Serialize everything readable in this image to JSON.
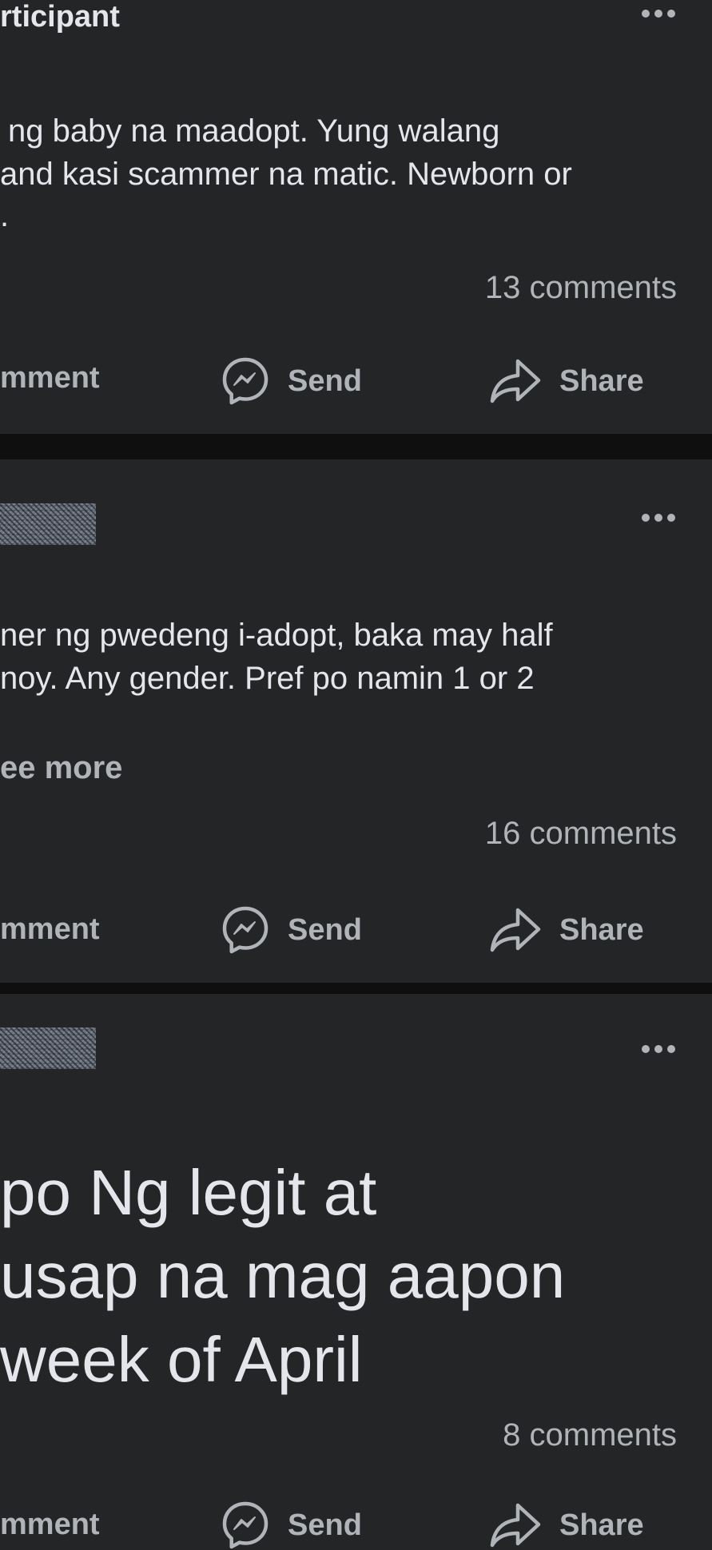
{
  "posts": [
    {
      "header_text": "rticipant",
      "body_lines": [
        "ng baby na maadopt. Yung walang",
        "and kasi scammer na matic. Newborn or",
        "."
      ],
      "comments": "13 comments",
      "actions": {
        "comment": "mment",
        "send": "Send",
        "share": "Share"
      }
    },
    {
      "body_lines": [
        "ner ng pwedeng i-adopt, baka may half",
        "noy. Any gender. Pref po namin 1 or 2"
      ],
      "see_more": "ee more",
      "comments": "16 comments",
      "actions": {
        "comment": "mment",
        "send": "Send",
        "share": "Share"
      }
    },
    {
      "big_lines": [
        "po Ng legit at",
        "usap na mag aapon",
        "week of April"
      ],
      "comments": "8 comments",
      "actions": {
        "comment": "mment",
        "send": "Send",
        "share": "Share"
      }
    }
  ],
  "icons": {
    "more": "more-options-icon",
    "send": "messenger-icon",
    "share": "share-arrow-icon"
  },
  "colors": {
    "background": "#242527",
    "divider": "#0f0f10",
    "primary_text": "#e4e6eb",
    "secondary_text": "#b0b3b8"
  }
}
